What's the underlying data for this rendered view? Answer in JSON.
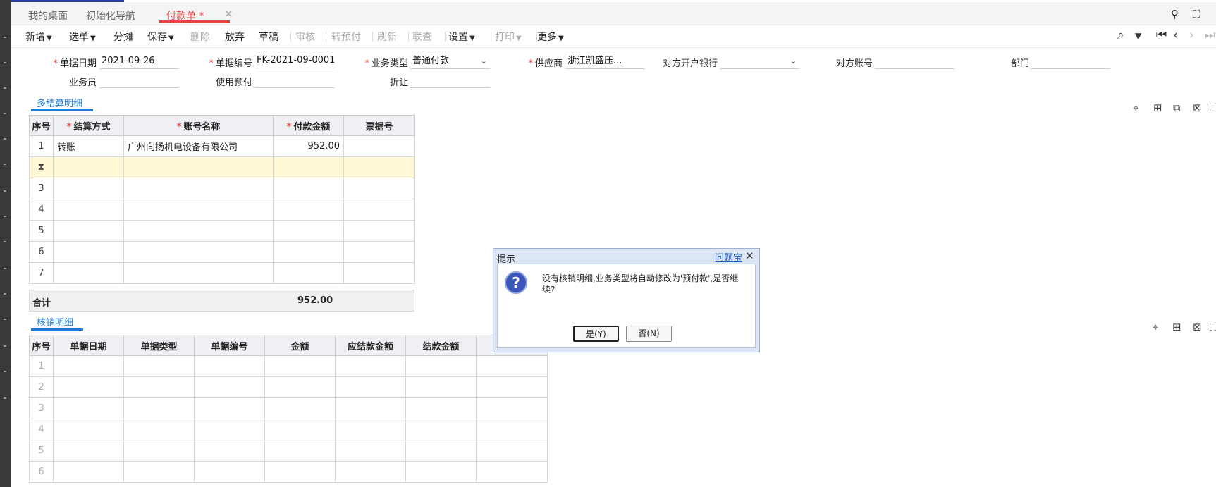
{
  "tabs": [
    {
      "label": "我的桌面"
    },
    {
      "label": "初始化导航"
    },
    {
      "label": "付款单 *"
    }
  ],
  "toolbar": {
    "new": "新增",
    "select": "选单",
    "split": "分摊",
    "save": "保存",
    "delete": "删除",
    "discard": "放弃",
    "draft": "草稿",
    "audit": "审核",
    "to_prepay": "转预付",
    "refresh": "刷新",
    "linked": "联查",
    "settings": "设置",
    "print": "打印",
    "more": "更多"
  },
  "form": {
    "doc_date": {
      "label": "单据日期",
      "value": "2021-09-26"
    },
    "doc_no": {
      "label": "单据编号",
      "value": "FK-2021-09-0001"
    },
    "biz_type": {
      "label": "业务类型",
      "value": "普通付款"
    },
    "supplier": {
      "label": "供应商",
      "value": "浙江凯盛压..."
    },
    "bank": {
      "label": "对方开户银行",
      "value": ""
    },
    "account": {
      "label": "对方账号",
      "value": ""
    },
    "dept": {
      "label": "部门",
      "value": ""
    },
    "staff": {
      "label": "业务员",
      "value": ""
    },
    "use_prepay": {
      "label": "使用预付",
      "value": ""
    },
    "discount": {
      "label": "折让",
      "value": ""
    }
  },
  "settlement": {
    "title": "多结算明细",
    "headers": [
      "序号",
      "结算方式",
      "账号名称",
      "付款金额",
      "票据号"
    ],
    "rows": [
      [
        "1",
        "转账",
        "广州向扬机电设备有限公司",
        "952.00",
        ""
      ],
      [
        "",
        "",
        "",
        "",
        ""
      ],
      [
        "3",
        "",
        "",
        "",
        ""
      ],
      [
        "4",
        "",
        "",
        "",
        ""
      ],
      [
        "5",
        "",
        "",
        "",
        ""
      ],
      [
        "6",
        "",
        "",
        "",
        ""
      ],
      [
        "7",
        "",
        "",
        "",
        ""
      ]
    ],
    "total_label": "合计",
    "total_value": "952.00"
  },
  "writeoff": {
    "title": "核销明细",
    "headers": [
      "序号",
      "单据日期",
      "单据类型",
      "单据编号",
      "金额",
      "应结款金额",
      "结款金额",
      ""
    ],
    "rows": [
      [
        "1"
      ],
      [
        "2"
      ],
      [
        "3"
      ],
      [
        "4"
      ],
      [
        "5"
      ],
      [
        "6"
      ]
    ]
  },
  "dialog": {
    "title": "提示",
    "help": "问题宝",
    "message": "没有核销明细,业务类型将自动修改为'预付款',是否继续?",
    "yes": "是(Y)",
    "no": "否(N)"
  }
}
